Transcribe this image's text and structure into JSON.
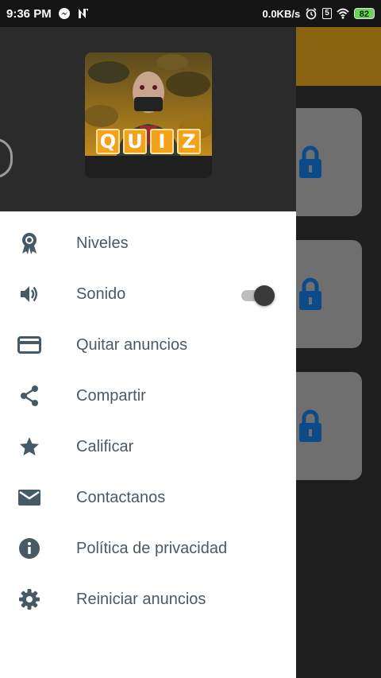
{
  "status_bar": {
    "time": "9:36 PM",
    "net_speed": "0.0KB/s",
    "sim_label": "5",
    "battery": "82"
  },
  "drawer": {
    "logo_letters": [
      "Q",
      "U",
      "I",
      "Z"
    ],
    "menu": [
      {
        "label": "Niveles",
        "icon": "award-icon"
      },
      {
        "label": "Sonido",
        "icon": "volume-icon",
        "toggle": true
      },
      {
        "label": "Quitar anuncios",
        "icon": "credit-card-icon"
      },
      {
        "label": "Compartir",
        "icon": "share-icon"
      },
      {
        "label": "Calificar",
        "icon": "star-icon"
      },
      {
        "label": "Contactanos",
        "icon": "mail-icon"
      },
      {
        "label": "Política de privacidad",
        "icon": "info-icon"
      },
      {
        "label": "Reiniciar anuncios",
        "icon": "gear-icon"
      }
    ]
  },
  "colors": {
    "menu_icon": "#455a64",
    "header_bg": "#2b2b2b",
    "toolbar_bg": "#8a6410",
    "lock": "#0d4a8a"
  }
}
